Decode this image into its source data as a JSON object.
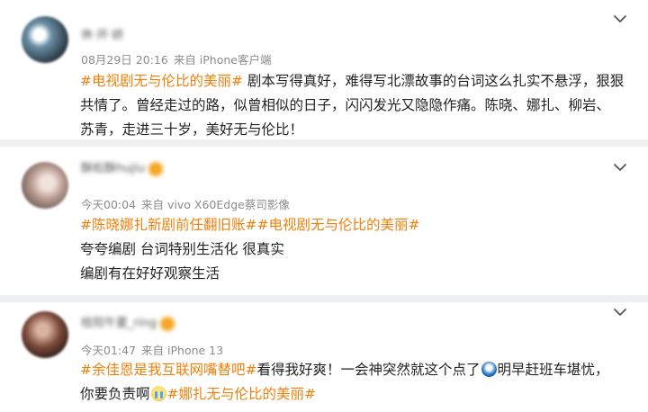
{
  "comments": [
    {
      "username": "休·开·娇",
      "date": "08月29日 20:16",
      "source": "来自 iPhone客户端",
      "lines": [
        [
          {
            "t": "#电视剧无与伦比的美丽#",
            "tag": true
          },
          {
            "t": " 剧本写得真好，难得写北漂故事的台词这么扎实不悬浮，狠狠",
            "tag": false
          }
        ],
        [
          {
            "t": "共情了。曾经走过的路，似曾相似的日子，闪闪发光又隐隐作痛。陈晓、娜扎、柳岩、",
            "tag": false
          }
        ],
        [
          {
            "t": "苏青，走进三十岁，美好无与伦比！",
            "tag": false
          }
        ]
      ]
    },
    {
      "username": "酥松酥hujiu",
      "date": "今天00:04",
      "source": "来自 vivo X60Edge蔡司影像",
      "lines": [
        [
          {
            "t": "#陈晓娜扎新剧前任翻旧账##电视剧无与伦比的美丽#",
            "tag": true
          }
        ],
        [
          {
            "t": "夸夸编剧 台词特别生活化 很真实",
            "tag": false
          }
        ],
        [
          {
            "t": "编剧有在好好观察生活",
            "tag": false
          }
        ]
      ]
    },
    {
      "username": "桂阳午夏_ring",
      "date": "今天01:47",
      "source": "来自 iPhone 13",
      "lines": [
        [
          {
            "t": "#余佳恩是我互联网嘴替吧#",
            "tag": true
          },
          {
            "t": "看得我好爽！一会神突然就这个点了",
            "tag": false
          },
          {
            "emoji": "face-emoji"
          },
          {
            "t": "明早赶班车堪忧，",
            "tag": false
          }
        ],
        [
          {
            "t": "你要负责啊",
            "tag": false
          },
          {
            "emoji": "crying-emoji"
          },
          {
            "t": "#娜扎无与伦比的美丽#",
            "tag": true
          }
        ]
      ]
    }
  ],
  "colors": {
    "tag": "#f0800c",
    "meta": "#8c8c8c",
    "text": "#222222",
    "background": "#eef0f2",
    "card": "#ffffff"
  },
  "icons": {
    "menu": "chevron-down-icon"
  }
}
